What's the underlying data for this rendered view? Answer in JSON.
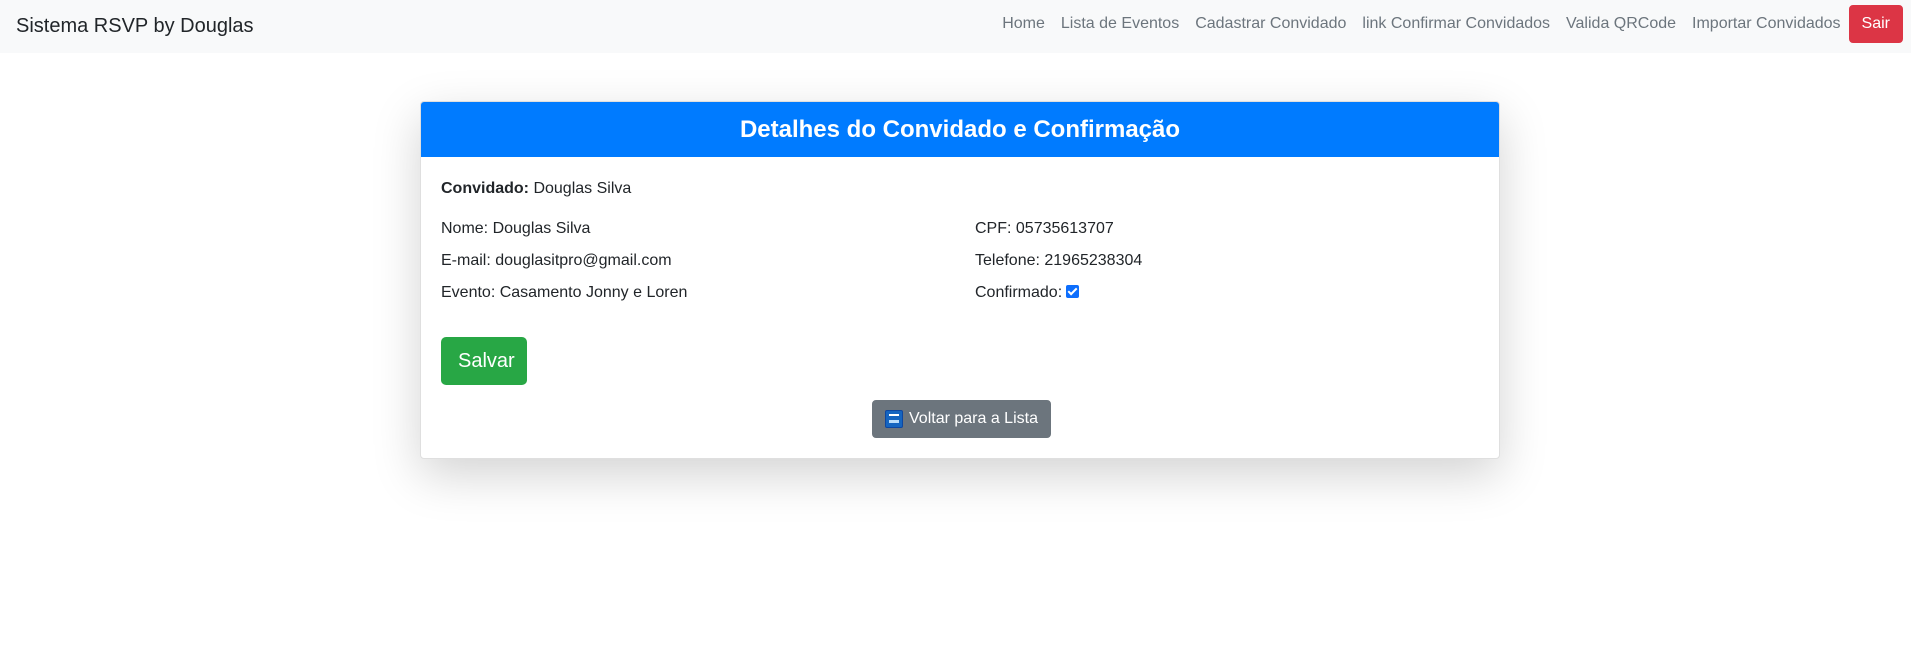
{
  "navbar": {
    "brand": "Sistema RSVP by Douglas",
    "links": [
      "Home",
      "Lista de Eventos",
      "Cadastrar Convidado",
      "link Confirmar Convidados",
      "Valida QRCode",
      "Importar Convidados"
    ],
    "logout_label": "Sair"
  },
  "card": {
    "title": "Detalhes do Convidado e Confirmação",
    "guest_label": "Convidado:",
    "guest_name": "Douglas Silva",
    "fields": {
      "nome": "Nome: Douglas Silva",
      "cpf": "CPF: 05735613707",
      "email": "E-mail: douglasitpro@gmail.com",
      "telefone": "Telefone: 21965238304",
      "evento": "Evento: Casamento Jonny e Loren",
      "confirmado": "Confirmado:"
    },
    "confirmado_checked": true,
    "save_label": "Salvar",
    "back_label": "Voltar para a Lista",
    "back_icon": "back-icon"
  },
  "colors": {
    "header": "#007bff",
    "success": "#28a745",
    "danger": "#dc3545",
    "secondary": "#6c757d"
  }
}
